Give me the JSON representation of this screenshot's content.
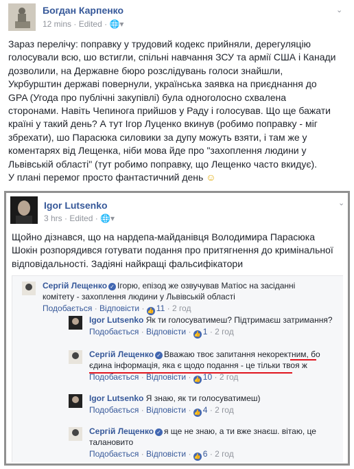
{
  "post": {
    "author": "Богдан Карпенко",
    "time": "12 mins",
    "edited": "Edited",
    "body_lines": [
      "Зараз перелічу: поправку у трудовий кодекс прийняли, дерегуляцію",
      "голосували всю, шо встигли, спільні навчання ЗСУ та армії США і Канади",
      "дозволили, на Державне бюро розслідувань голоси знайшли,",
      "Укрбурштин державі повернули, українська заявка на приєднання до",
      "GPA (Угода про публічні закупівлі) була одноголосно схвалена",
      "сторонами. Навіть Чепинога прийшов у Раду і голосував. Що ще бажати",
      "країні у такий день? А тут Ігор Луценко вкинув (робимо поправку - міг",
      "збрехати), шо Парасюка силовики за дупу можуть взяти, і там же у",
      "коментарях від Лещенка, ніби мова йде про \"захоплення людини у",
      "Львівській області\" (тут робимо поправку, що Лещенко часто вкидує).",
      "У плані перемог просто фантастичний день"
    ],
    "emoji": "smile-emoji"
  },
  "shared": {
    "author": "Igor Lutsenko",
    "time": "3 hrs",
    "edited": "Edited",
    "body_lines": [
      "Щойно дізнався, що на нардепа-майданівця Володимира Парасюка",
      "Шокін розпорядився готувати подання про притягнення до кримінальної",
      "відповідальності. Задіяні найкращі фальсифікатори"
    ]
  },
  "comments": [
    {
      "name": "Сергій Лещенко",
      "verified": true,
      "lines": [
        "Ігорю, епізод же озвучував Матіос на засіданні",
        "комітету - захоплення людини у Львівській області"
      ],
      "like": "Подобається",
      "reply": "Відповісти",
      "likes": "11",
      "time": "2 год"
    },
    {
      "name": "Igor Lutsenko",
      "verified": false,
      "lines": [
        "Як ти голосуватимеш? Підтримаєш затримання?"
      ],
      "like": "Подобається",
      "reply": "Відповісти",
      "likes": "1",
      "time": "2 год"
    },
    {
      "name": "Сергій Лещенко",
      "verified": true,
      "lines": [
        "Вважаю твоє запитання некоректним, бо",
        "єдина інформація, яка є щодо подання - це тільки твоя ж"
      ],
      "like": "Подобається",
      "reply": "Відповісти",
      "likes": "10",
      "time": "2 год"
    },
    {
      "name": "Igor Lutsenko",
      "verified": false,
      "lines": [
        "Я знаю, як ти голосуватимеш)"
      ],
      "like": "Подобається",
      "reply": "Відповісти",
      "likes": "4",
      "time": "2 год"
    },
    {
      "name": "Сергій Лещенко",
      "verified": true,
      "lines": [
        "я ще не знаю, а ти вже знаєш. вітаю, це",
        "талановито"
      ],
      "like": "Подобається",
      "reply": "Відповісти",
      "likes": "6",
      "time": "2 год"
    }
  ],
  "separator": "·",
  "colors": {
    "link": "#365899",
    "meta": "#90949c",
    "highlight": "#e0141e",
    "frame": "#909090"
  }
}
